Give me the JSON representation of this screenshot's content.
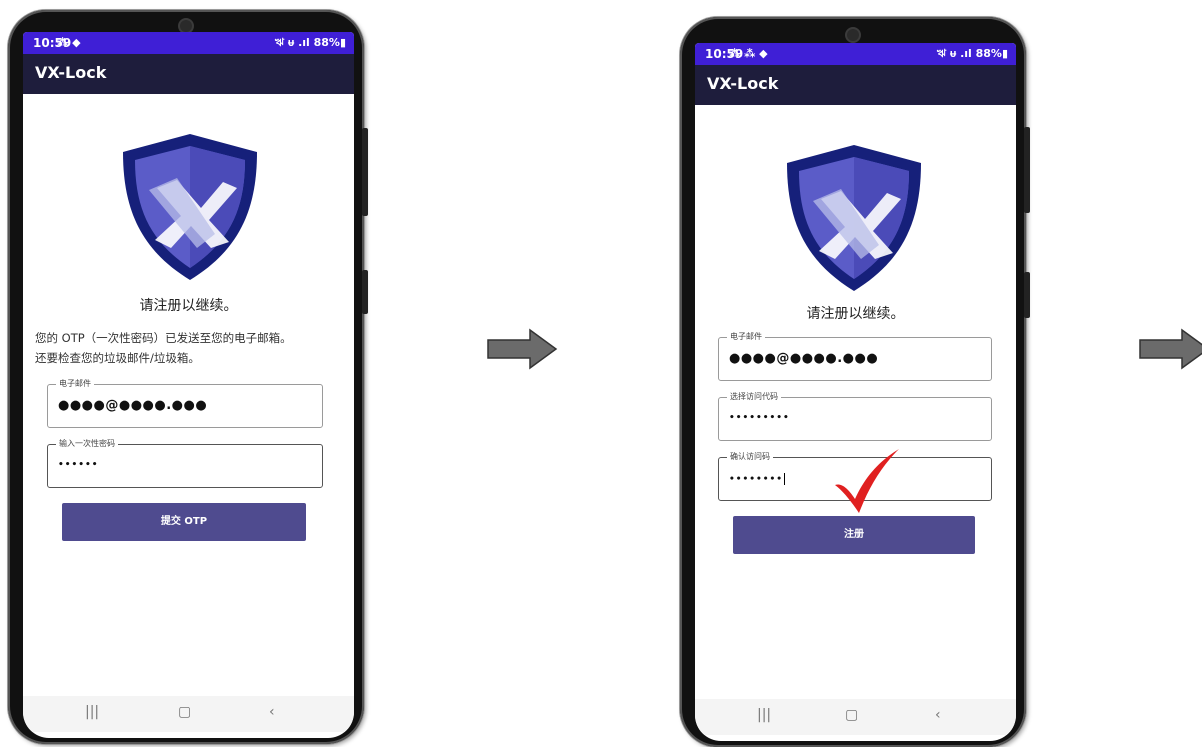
{
  "colors": {
    "status_bar": "#3f1fd6",
    "app_bar": "#1e1d3c",
    "button": "#4f4b8f",
    "shield_outer": "#16207a",
    "shield_inner": "#5b5cc8",
    "checkmark": "#e02020",
    "arrow_fill": "#6b6b6b"
  },
  "phone1": {
    "status_time": "10:59",
    "status_left_icons": "⁂ ◆",
    "status_right": "ঋ ᵾ .ıl 88%▮",
    "app_title": "VX-Lock",
    "logo_icon": "shield-vx-logo",
    "heading": "请注册以继续。",
    "description_line1": "您的 OTP（一次性密码）已发送至您的电子邮箱。",
    "description_line2": "还要检查您的垃圾邮件/垃圾箱。",
    "email_label": "电子邮件",
    "email_value": "●●●●@●●●●.●●●",
    "otp_label": "输入一次性密码",
    "otp_value": "••••••",
    "submit_button": "提交 OTP",
    "nav": {
      "recents": "|||",
      "home": "▢",
      "back": "‹"
    }
  },
  "phone2": {
    "status_time": "10:59",
    "status_left_icons": "⁂ ⁂ ◆",
    "status_right": "ঋ ᵾ .ıl 88%▮",
    "app_title": "VX-Lock",
    "logo_icon": "shield-vx-logo",
    "heading": "请注册以继续。",
    "email_label": "电子邮件",
    "email_value": "●●●●@●●●●.●●●",
    "access_code_label": "选择访问代码",
    "access_code_value": "•••••••••",
    "confirm_label": "确认访问码",
    "confirm_value": "••••••••",
    "register_button": "注册",
    "checkmark_icon": "red-checkmark-icon",
    "nav": {
      "recents": "|||",
      "home": "▢",
      "back": "‹"
    }
  },
  "arrows": [
    "right-arrow-icon",
    "right-arrow-icon"
  ]
}
